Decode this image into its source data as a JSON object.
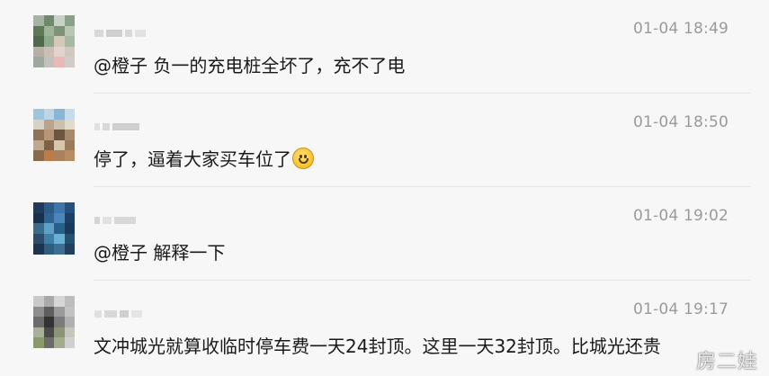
{
  "comments": [
    {
      "timestamp": "01-04 18:49",
      "text": "@橙子 负一的充电桩全坏了，充不了电"
    },
    {
      "timestamp": "01-04 18:50",
      "text": "停了，逼着大家买车位了",
      "emoji": "smile-emoji"
    },
    {
      "timestamp": "01-04 19:02",
      "text": "@橙子 解释一下"
    },
    {
      "timestamp": "01-04 19:17",
      "text": "文冲城光就算收临时停车费一天24封顶。这里一天32封顶。比城光还贵"
    }
  ],
  "watermark": "房二娃"
}
